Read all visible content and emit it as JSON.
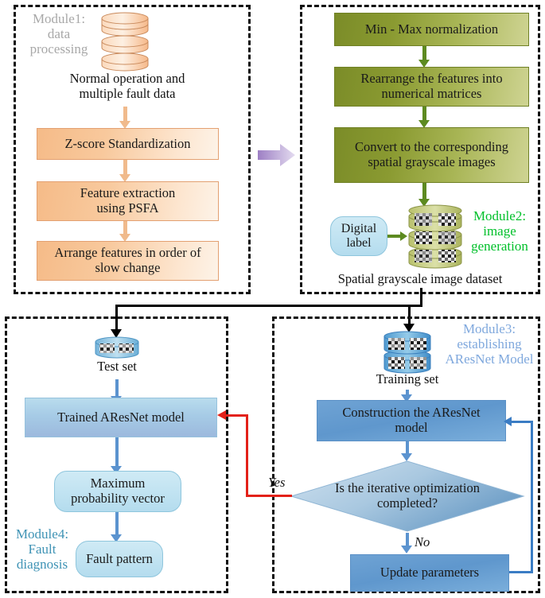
{
  "modules": {
    "m1": {
      "label": "Module1:\ndata\nprocessing",
      "color": "#a8a8a8"
    },
    "m2": {
      "label": "Module2:\nimage\ngeneration",
      "color": "#00c02a"
    },
    "m3": {
      "label": "Module3:\nestablishing\nAResNet Model",
      "color": "#7fa8dd"
    },
    "m4": {
      "label": "Module4:\nFault\ndiagnosis",
      "color": "#3f93b5"
    }
  },
  "module1": {
    "source_caption": "Normal operation and\nmultiple fault data",
    "steps": [
      "Z-score Standardization",
      "Feature extraction\nusing PSFA",
      "Arrange features in order of\nslow change"
    ]
  },
  "module2": {
    "steps": [
      "Min - Max normalization",
      "Rearrange the features into\nnumerical matrices",
      "Convert to the corresponding\nspatial grayscale images"
    ],
    "digital_label": "Digital\nlabel",
    "dataset_caption": "Spatial grayscale image dataset"
  },
  "module3": {
    "dataset_caption": "Training set",
    "construct_box": "Construction the AResNet\nmodel",
    "decision": "Is the iterative optimization\ncompleted?",
    "yes_label": "Yes",
    "no_label": "No",
    "update_box": "Update parameters"
  },
  "module4": {
    "dataset_caption": "Test set",
    "trained_box": "Trained AResNet model",
    "max_prob_box": "Maximum\nprobability vector",
    "fault_box": "Fault pattern"
  },
  "colors": {
    "orange_box": "#f5bb88",
    "green_box": "#8a9a31",
    "blue_box": "#6fa3d4",
    "light_blue_box": "#b9dced",
    "red_arrow": "#e32119",
    "blue_arrow": "#5b93cf",
    "purple_arrow": "#b89ed6",
    "frame": "#111111"
  }
}
